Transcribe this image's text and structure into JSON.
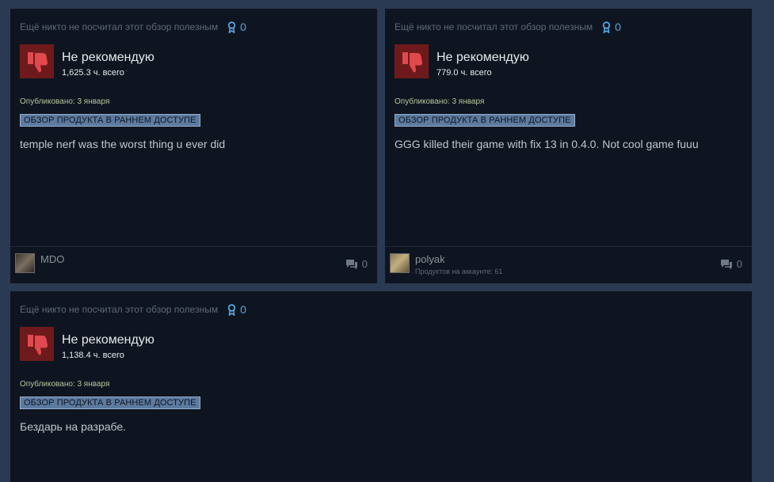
{
  "colors": {
    "background": "#2a3a52",
    "card": "#0f1520",
    "thumb_bg": "#6e1a1c",
    "thumb_icon": "#e0494d",
    "award": "#58a5e0",
    "posted_text": "#b6c49a",
    "badge_bg": "#5d7a9f"
  },
  "reviews": [
    {
      "helpful_text": "Ещё никто не посчитал этот обзор полезным",
      "award_count": "0",
      "verdict": "Не рекомендую",
      "hours": "1,625.3 ч. всего",
      "posted": "Опубликовано: 3 января",
      "badge": "Обзор продукта в раннем доступе",
      "content": "temple nerf was the worst thing u ever did",
      "author": "MDO",
      "products": "",
      "comment_count": "0",
      "thumb_icon": "thumbs-down-icon"
    },
    {
      "helpful_text": "Ещё никто не посчитал этот обзор полезным",
      "award_count": "0",
      "verdict": "Не рекомендую",
      "hours": "779.0 ч. всего",
      "posted": "Опубликовано: 3 января",
      "badge": "Обзор продукта в раннем доступе",
      "content": "GGG killed their game with fix 13 in 0.4.0. Not cool game fuuu",
      "author": "polyak",
      "products": "Продуктов на аккаунте: 61",
      "comment_count": "0",
      "thumb_icon": "thumbs-down-icon"
    },
    {
      "helpful_text": "Ещё никто не посчитал этот обзор полезным",
      "award_count": "0",
      "verdict": "Не рекомендую",
      "hours": "1,138.4 ч. всего",
      "posted": "Опубликовано: 3 января",
      "badge": "Обзор продукта в раннем доступе",
      "content": "Бездарь на разрабе.",
      "thumb_icon": "thumbs-down-icon"
    }
  ]
}
